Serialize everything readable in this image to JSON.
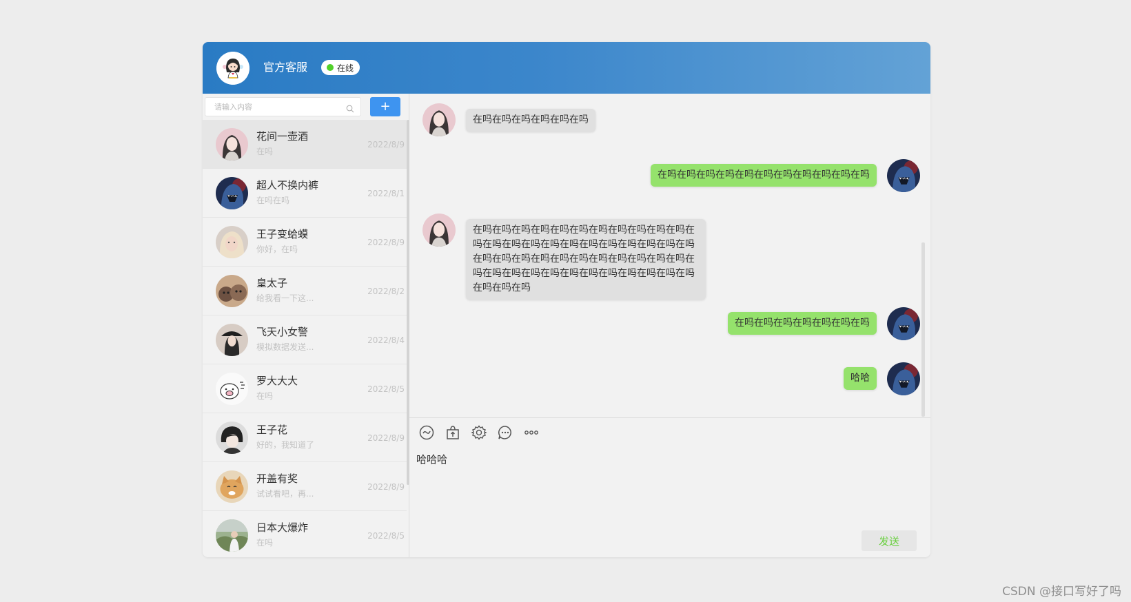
{
  "header": {
    "title": "官方客服",
    "status": "在线",
    "avatar_icon": "girl-avatar-icon"
  },
  "sidebar": {
    "search_placeholder": "请输入内容",
    "add_label": "+",
    "contacts": [
      {
        "name": "花间一壶酒",
        "preview": "在吗",
        "date": "2022/8/9",
        "active": true,
        "avatar": "girl-portrait"
      },
      {
        "name": "超人不换内裤",
        "preview": "在吗在吗",
        "date": "2022/8/1",
        "active": false,
        "avatar": "shark-monster"
      },
      {
        "name": "王子变蛤蟆",
        "preview": "你好，在吗",
        "date": "2022/8/9",
        "active": false,
        "avatar": "blonde-girl"
      },
      {
        "name": "皇太子",
        "preview": "给我看一下这...",
        "date": "2022/8/2",
        "active": false,
        "avatar": "cats"
      },
      {
        "name": "飞天小女警",
        "preview": "模拟数据发送...",
        "date": "2022/8/4",
        "active": false,
        "avatar": "hat-girl"
      },
      {
        "name": "罗大大大",
        "preview": "在吗",
        "date": "2022/8/5",
        "active": false,
        "avatar": "pig-cartoon"
      },
      {
        "name": "王子花",
        "preview": "好的，我知道了",
        "date": "2022/8/9",
        "active": false,
        "avatar": "anime-boy"
      },
      {
        "name": "开盖有奖",
        "preview": "试试看吧，再...",
        "date": "2022/8/9",
        "active": false,
        "avatar": "cat-face"
      },
      {
        "name": "日本大爆炸",
        "preview": "在吗",
        "date": "2022/8/5",
        "active": false,
        "avatar": "man-outdoor"
      }
    ]
  },
  "chat": {
    "messages": [
      {
        "side": "left",
        "lines": [
          "在吗在吗在吗在吗在吗在吗"
        ]
      },
      {
        "side": "right",
        "lines": [
          "在吗在吗在吗在吗在吗在吗在吗在吗在吗在吗在吗"
        ]
      },
      {
        "side": "left",
        "lines": [
          "在吗在吗在吗在吗在吗在吗在吗在吗在吗在吗在吗在吗在吗在吗在吗在吗在吗在吗在吗在吗在吗在吗在吗在吗在吗在吗在吗在吗在吗在吗在吗在吗在吗在吗在吗在吗在吗在吗在吗在吗在吗在吗在吗在吗在吗在吗在吗在吗在吗"
        ]
      },
      {
        "side": "right",
        "lines": [
          "在吗在吗在吗在吗在吗在吗在吗"
        ]
      },
      {
        "side": "right",
        "lines": [
          "哈哈"
        ]
      }
    ],
    "toolbar": [
      "emoji-icon",
      "upload-file-icon",
      "settings-icon",
      "chat-bubble-icon",
      "more-icon"
    ],
    "input_value": "哈哈哈",
    "send_label": "发送"
  },
  "watermark": "CSDN @接口写好了吗",
  "colors": {
    "header_start": "#2a7bc4",
    "header_end": "#63a2d6",
    "add_button": "#3e94f0",
    "bubble_right": "#95e26c",
    "bubble_left": "#e0e0e0",
    "send_text": "#67cf3c",
    "online_dot": "#52d12a"
  }
}
